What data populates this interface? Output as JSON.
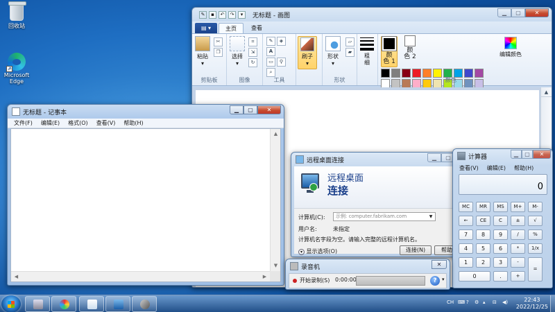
{
  "desktop": {
    "icons": [
      {
        "label": "回收站",
        "icon": "recycle-bin-icon"
      },
      {
        "label": "Microsoft\nEdge",
        "icon": "edge-icon"
      }
    ]
  },
  "paint": {
    "title": "无标题 - 画图",
    "tabs": [
      "主页",
      "查看"
    ],
    "groups": {
      "clipboard": {
        "label": "剪贴板",
        "paste": "粘贴"
      },
      "image": {
        "label": "图像",
        "select": "选择"
      },
      "tools": {
        "label": "工具",
        "brushes": "刷子"
      },
      "shapes": {
        "label": "形状",
        "shape": "形状"
      },
      "size": "粗\n细",
      "color1": "颜\n色 1",
      "color2": "颜\n色 2",
      "colors": {
        "label": "颜色",
        "edit": "编辑颜色"
      }
    },
    "palette": [
      "#000000",
      "#7f7f7f",
      "#880015",
      "#ed1c24",
      "#ff7f27",
      "#fff200",
      "#22b14c",
      "#00a2e8",
      "#3f48cc",
      "#a349a4",
      "#ffffff",
      "#c3c3c3",
      "#b97a57",
      "#ffaec9",
      "#ffc90e",
      "#efe4b0",
      "#b5e61d",
      "#99d9ea",
      "#7092be",
      "#c8bfe7",
      "#ffffff",
      "#ffffff",
      "#ffffff",
      "#ffffff",
      "#ffffff",
      "#ffffff",
      "#ffffff",
      "#ffffff",
      "#ffffff",
      "#ffffff"
    ],
    "color1": "#000000",
    "color2": "#ffffff"
  },
  "notepad": {
    "title": "无标题 - 记事本",
    "menu": [
      "文件(F)",
      "编辑(E)",
      "格式(O)",
      "查看(V)",
      "帮助(H)"
    ]
  },
  "rdp": {
    "title": "远程桌面连接",
    "heading1": "远程桌面",
    "heading2": "连接",
    "computer_label": "计算机(C):",
    "computer_placeholder": "示例: computer.fabrikam.com",
    "user_label": "用户名:",
    "user_value": "未指定",
    "hint": "计算机名字段为空。请输入完整的远程计算机名。",
    "options": "显示选项(O)",
    "connect": "连接(N)",
    "help": "帮助"
  },
  "calculator": {
    "title": "计算器",
    "menu": [
      "查看(V)",
      "编辑(E)",
      "帮助(H)"
    ],
    "display": "0",
    "keys": [
      [
        "MC",
        "MR",
        "MS",
        "M+",
        "M-"
      ],
      [
        "←",
        "CE",
        "C",
        "±",
        "√"
      ],
      [
        "7",
        "8",
        "9",
        "/",
        "%"
      ],
      [
        "4",
        "5",
        "6",
        "*",
        "1/x"
      ],
      [
        "1",
        "2",
        "3",
        "-",
        "="
      ],
      [
        "0",
        ".",
        "+"
      ]
    ]
  },
  "recorder": {
    "title": "录音机",
    "start": "开始录制(S)",
    "time": "0:00:00",
    "help": "?"
  },
  "taskbar": {
    "pinned": [
      "calculator-icon",
      "paint-icon",
      "notepad-icon",
      "remote-desktop-icon",
      "recorder-icon"
    ],
    "lang": "CH",
    "time": "22:43",
    "date": "2022/12/25"
  }
}
